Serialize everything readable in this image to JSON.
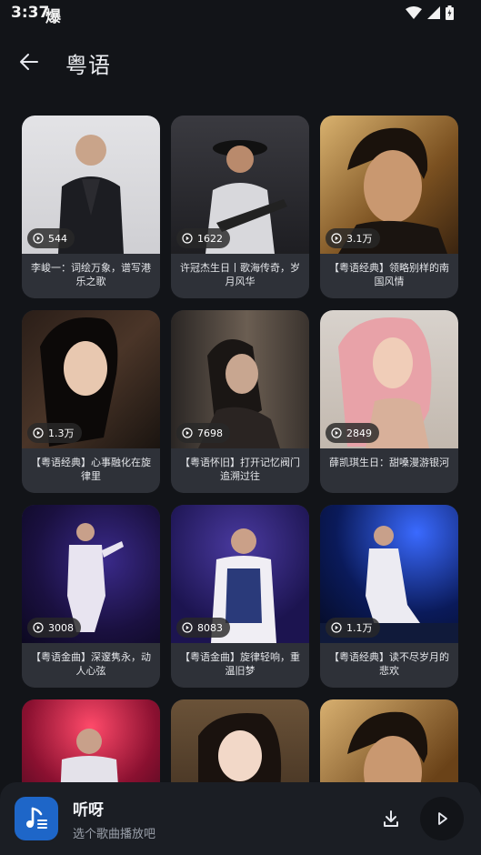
{
  "status": {
    "time": "3:37",
    "app_glyph": "爆"
  },
  "header": {
    "title": "粤语",
    "back_icon": "arrow-left-icon"
  },
  "cards": [
    {
      "plays": "544",
      "title": "李峻一：词绘万象，谱写港乐之歌"
    },
    {
      "plays": "1622",
      "title": "许冠杰生日丨歌海传奇，岁月风华"
    },
    {
      "plays": "3.1万",
      "title": "【粤语经典】领略别样的南国风情"
    },
    {
      "plays": "1.3万",
      "title": "【粤语经典】心事融化在旋律里"
    },
    {
      "plays": "7698",
      "title": "【粤语怀旧】打开记忆阀门追溯过往"
    },
    {
      "plays": "2849",
      "title": "薛凯琪生日：甜嗓漫游银河"
    },
    {
      "plays": "3008",
      "title": "【粤语金曲】深邃隽永，动人心弦"
    },
    {
      "plays": "8083",
      "title": "【粤语金曲】旋律轻响，重温旧梦"
    },
    {
      "plays": "1.1万",
      "title": "【粤语经典】读不尽岁月的悲欢"
    },
    {
      "plays": "",
      "title": ""
    },
    {
      "plays": "",
      "title": ""
    },
    {
      "plays": "",
      "title": ""
    }
  ],
  "player": {
    "name": "听呀",
    "subtitle": "选个歌曲播放吧"
  },
  "colors": {
    "background": "#121418",
    "card": "#2e3138",
    "accent": "#1e66c8"
  }
}
